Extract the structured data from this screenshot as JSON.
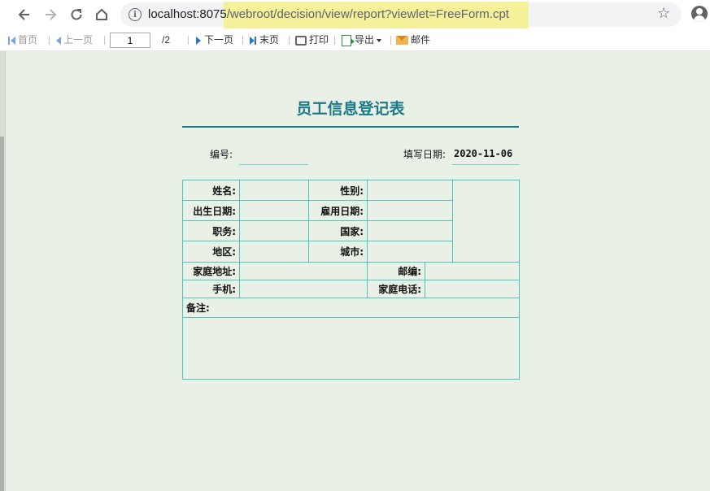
{
  "browser": {
    "url_host": "localhost:8075",
    "url_path": "/webroot/decision/view/report?viewlet=FreeForm.cpt"
  },
  "toolbar": {
    "first_page": "首页",
    "prev_page": "上一页",
    "current_page": "1",
    "total_pages": "/2",
    "next_page": "下一页",
    "last_page": "末页",
    "print": "打印",
    "export": "导出",
    "email": "邮件"
  },
  "form": {
    "title": "员工信息登记表",
    "number_label": "编号:",
    "number_value": "",
    "date_label": "填写日期:",
    "date_value": "2020-11-06",
    "fields": {
      "name": "姓名:",
      "gender": "性别:",
      "birth_date": "出生日期:",
      "hire_date": "雇用日期:",
      "position": "职务:",
      "country": "国家:",
      "region": "地区:",
      "city": "城市:",
      "home_address": "家庭地址:",
      "postcode": "邮编:",
      "mobile": "手机:",
      "home_phone": "家庭电话:",
      "remarks": "备注:"
    }
  }
}
